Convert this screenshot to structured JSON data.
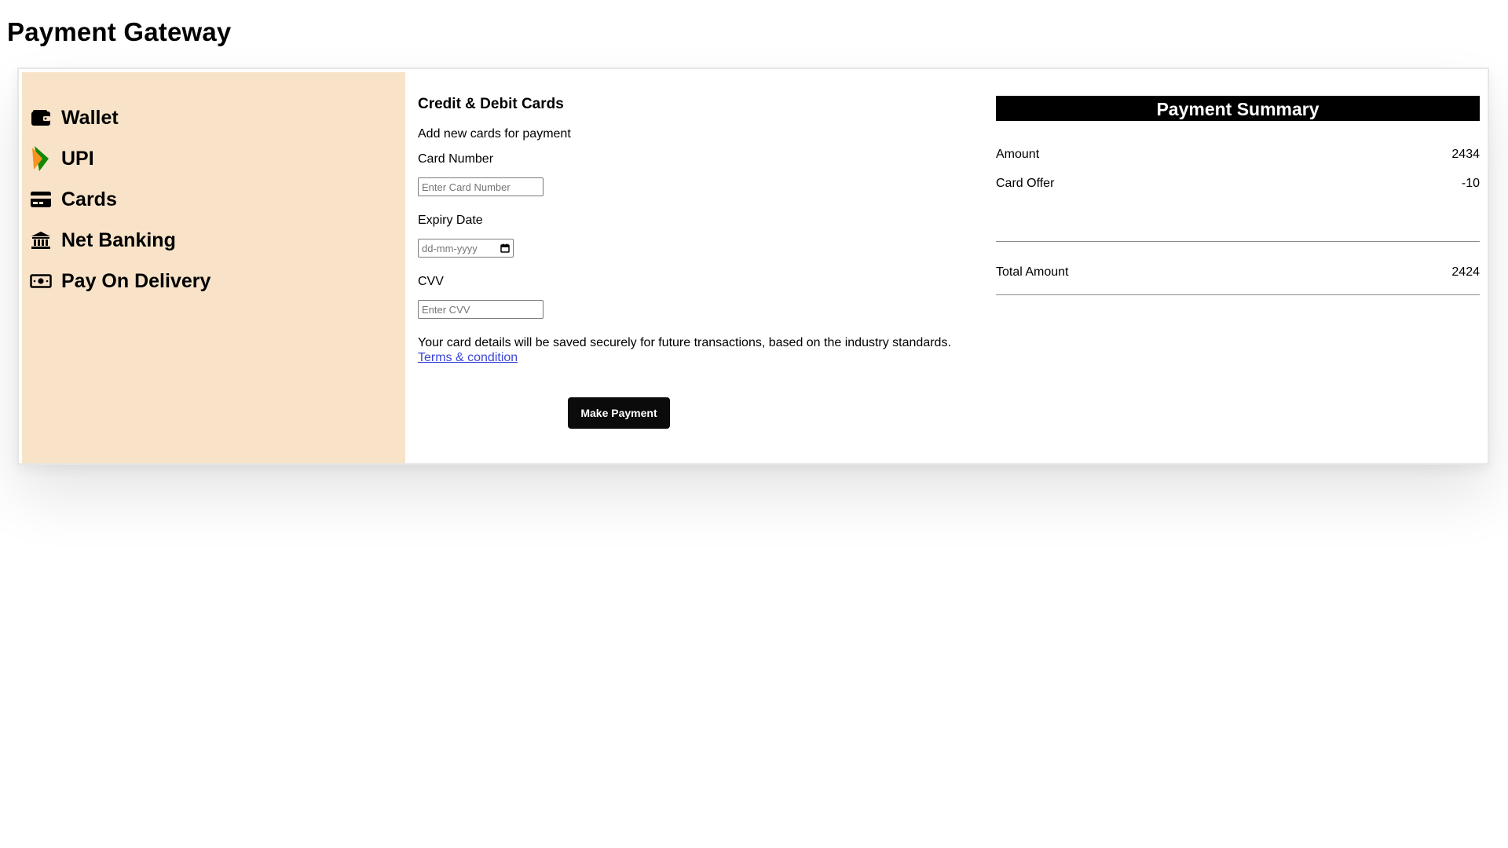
{
  "page": {
    "title": "Payment Gateway"
  },
  "sidebar": {
    "items": [
      {
        "label": "Wallet",
        "icon": "wallet-icon"
      },
      {
        "label": "UPI",
        "icon": "upi-icon"
      },
      {
        "label": "Cards",
        "icon": "credit-card-icon"
      },
      {
        "label": "Net Banking",
        "icon": "bank-icon"
      },
      {
        "label": "Pay On Delivery",
        "icon": "cash-icon"
      }
    ],
    "background": "#f8e3c9"
  },
  "form": {
    "heading": "Credit & Debit Cards",
    "subheading": "Add new cards for payment",
    "card_number_label": "Card Number",
    "card_number_placeholder": "Enter Card Number",
    "expiry_label": "Expiry Date",
    "expiry_placeholder": "dd-mm-yyyy",
    "cvv_label": "CVV",
    "cvv_placeholder": "Enter CVV",
    "notice": "Your card details will be saved securely for future transactions, based on the industry standards.",
    "terms_link": "Terms & condition",
    "submit_label": "Make Payment"
  },
  "summary": {
    "title": "Payment Summary",
    "rows": [
      {
        "label": "Amount",
        "value": "2434"
      },
      {
        "label": "Card Offer",
        "value": "-10"
      }
    ],
    "total_label": "Total Amount",
    "total_value": "2424"
  },
  "colors": {
    "link": "#3b45d6",
    "button": "#0b0b0b",
    "summary_header": "#000000"
  }
}
